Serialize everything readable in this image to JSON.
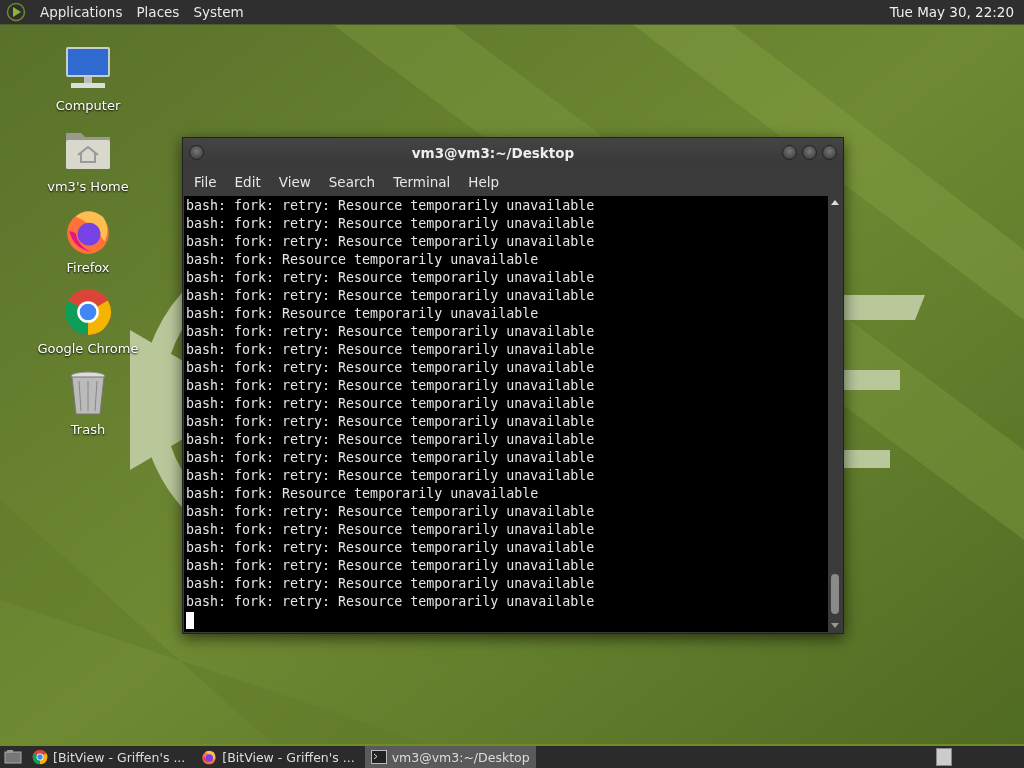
{
  "top_panel": {
    "menus": [
      "Applications",
      "Places",
      "System"
    ],
    "clock": "Tue May 30, 22:20"
  },
  "desktop_icons": [
    {
      "kind": "computer",
      "label": "Computer"
    },
    {
      "kind": "home",
      "label": "vm3's Home"
    },
    {
      "kind": "firefox",
      "label": "Firefox"
    },
    {
      "kind": "chrome",
      "label": "Google Chrome"
    },
    {
      "kind": "trash",
      "label": "Trash"
    }
  ],
  "terminal": {
    "title": "vm3@vm3:~/Desktop",
    "menus": [
      "File",
      "Edit",
      "View",
      "Search",
      "Terminal",
      "Help"
    ],
    "lines": [
      "bash: fork: retry: Resource temporarily unavailable",
      "bash: fork: retry: Resource temporarily unavailable",
      "bash: fork: retry: Resource temporarily unavailable",
      "bash: fork: Resource temporarily unavailable",
      "bash: fork: retry: Resource temporarily unavailable",
      "bash: fork: retry: Resource temporarily unavailable",
      "bash: fork: Resource temporarily unavailable",
      "bash: fork: retry: Resource temporarily unavailable",
      "bash: fork: retry: Resource temporarily unavailable",
      "bash: fork: retry: Resource temporarily unavailable",
      "bash: fork: retry: Resource temporarily unavailable",
      "bash: fork: retry: Resource temporarily unavailable",
      "bash: fork: retry: Resource temporarily unavailable",
      "bash: fork: retry: Resource temporarily unavailable",
      "bash: fork: retry: Resource temporarily unavailable",
      "bash: fork: retry: Resource temporarily unavailable",
      "bash: fork: Resource temporarily unavailable",
      "bash: fork: retry: Resource temporarily unavailable",
      "bash: fork: retry: Resource temporarily unavailable",
      "bash: fork: retry: Resource temporarily unavailable",
      "bash: fork: retry: Resource temporarily unavailable",
      "bash: fork: retry: Resource temporarily unavailable",
      "bash: fork: retry: Resource temporarily unavailable"
    ]
  },
  "taskbar": {
    "items": [
      {
        "kind": "chrome",
        "label": "[BitView - Griffen's ...",
        "selected": false
      },
      {
        "kind": "firefox",
        "label": "[BitView - Griffen's ...",
        "selected": false
      },
      {
        "kind": "terminal",
        "label": "vm3@vm3:~/Desktop",
        "selected": true
      }
    ]
  }
}
